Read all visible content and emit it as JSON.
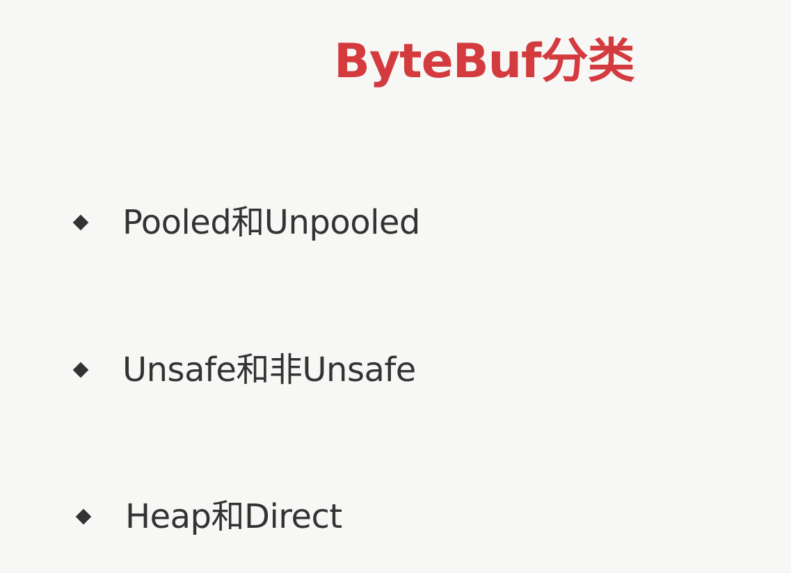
{
  "slide": {
    "title": "ByteBuf分类",
    "bullets": [
      {
        "text": "Pooled和Unpooled",
        "icon": "diamond-bullet-icon"
      },
      {
        "text": "Unsafe和非Unsafe",
        "icon": "diamond-bullet-icon"
      },
      {
        "text": "Heap和Direct",
        "icon": "diamond-bullet-icon"
      }
    ]
  },
  "colors": {
    "background": "#f7f7f5",
    "title": "#d33b3f",
    "text": "#333333",
    "bullet": "#333333"
  }
}
